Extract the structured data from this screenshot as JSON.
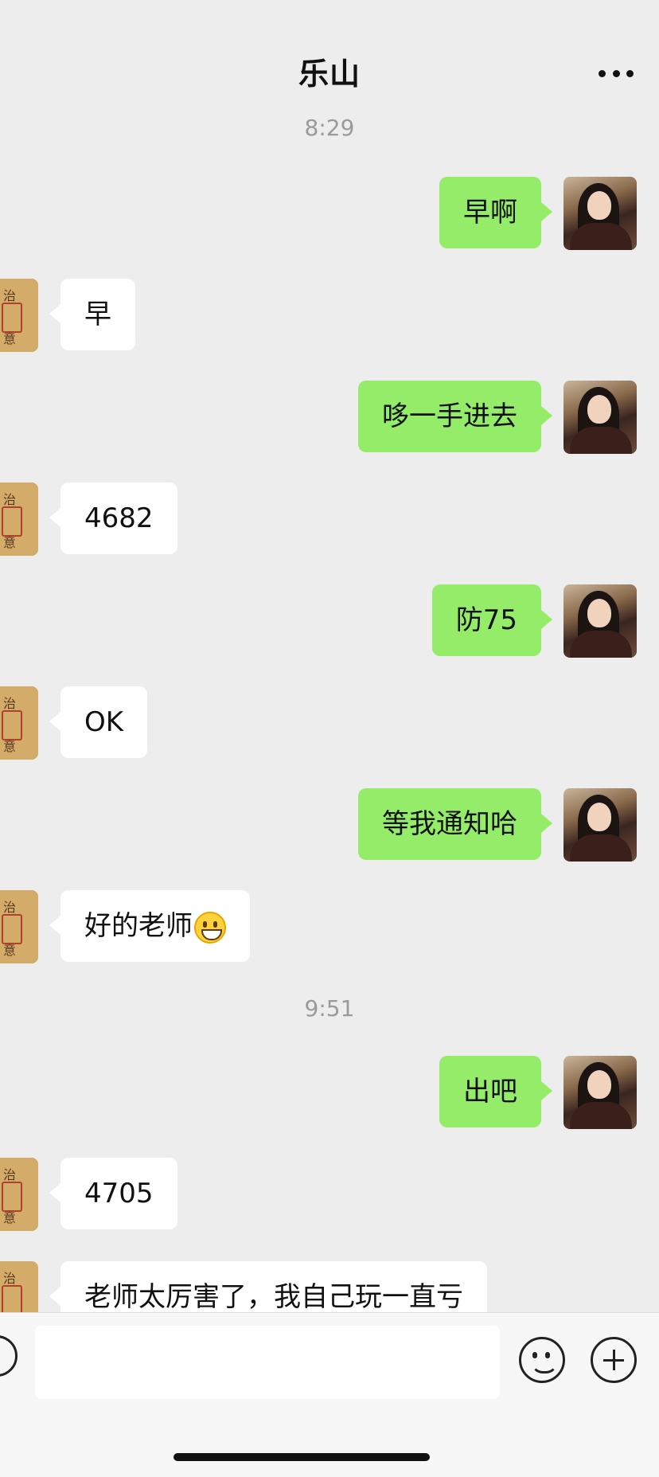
{
  "header": {
    "title": "乐山"
  },
  "timestamps": [
    "8:29",
    "9:51"
  ],
  "messages": [
    {
      "from": "me",
      "text": "早啊"
    },
    {
      "from": "other",
      "text": "早"
    },
    {
      "from": "me",
      "text": "哆一手进去"
    },
    {
      "from": "other",
      "text": "4682"
    },
    {
      "from": "me",
      "text": "防75"
    },
    {
      "from": "other",
      "text": "OK"
    },
    {
      "from": "me",
      "text": "等我通知哈"
    },
    {
      "from": "other",
      "text": "好的老师",
      "emoji": "grinning-face"
    },
    {
      "from": "me",
      "text": "出吧"
    },
    {
      "from": "other",
      "text": "4705"
    },
    {
      "from": "other",
      "text": "老师太厉害了，我自己玩一直亏"
    }
  ],
  "input_bar": {
    "placeholder": ""
  },
  "icons": {
    "more": "more-icon",
    "voice": "voice-icon",
    "emoji": "emoji-icon",
    "plus": "plus-icon"
  },
  "colors": {
    "background": "#ededed",
    "outgoing_bubble": "#95ec69",
    "incoming_bubble": "#ffffff"
  }
}
